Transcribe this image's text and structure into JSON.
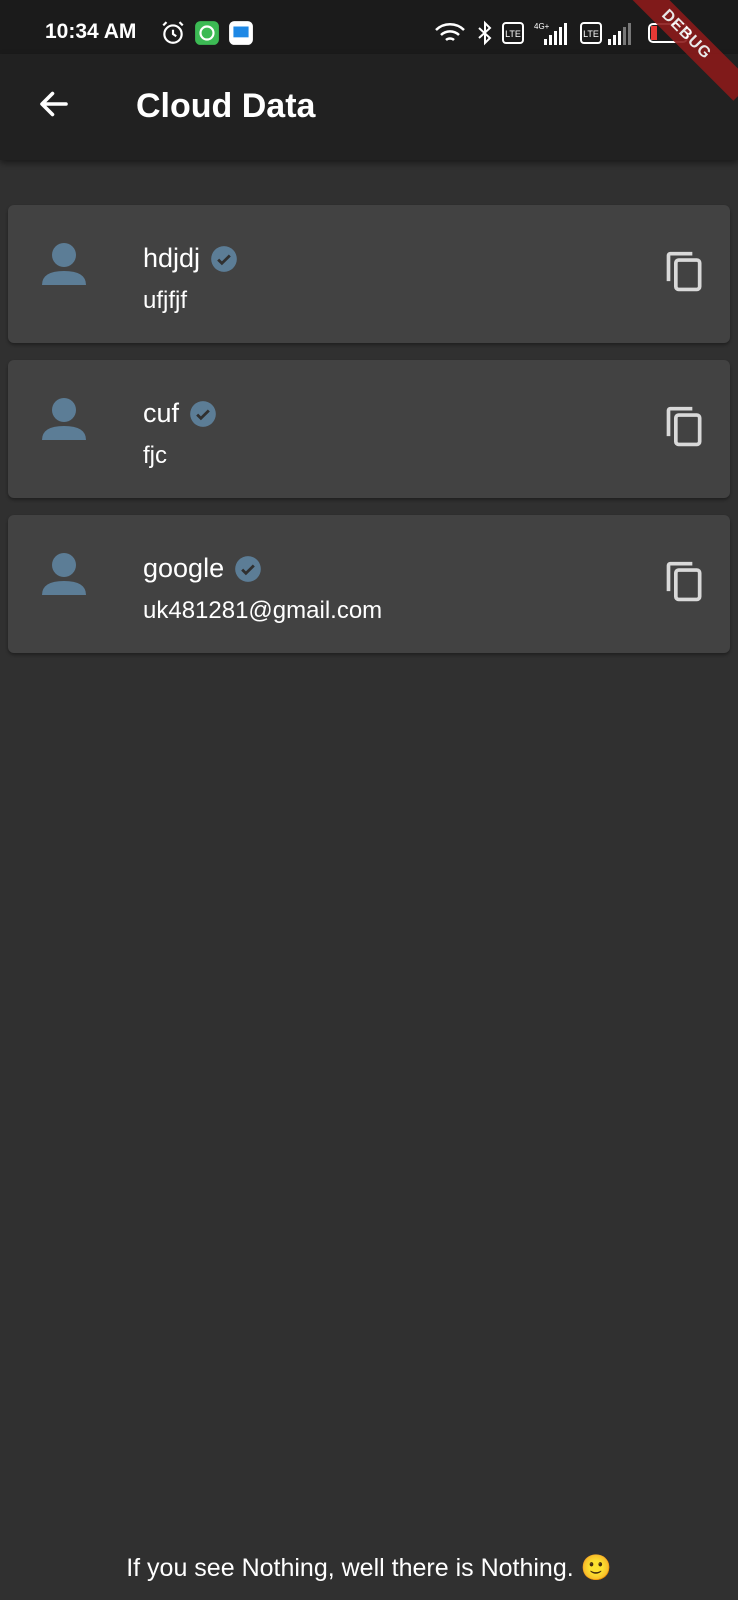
{
  "status_bar": {
    "time": "10:34 AM",
    "battery": "15",
    "icons": [
      "alarm-icon",
      "app-notification-icon",
      "app-notification-icon",
      "wifi-icon",
      "bluetooth-icon",
      "volte-icon",
      "signal-icon",
      "battery-icon"
    ]
  },
  "app_bar": {
    "title": "Cloud Data",
    "back_icon": "arrow-back-icon",
    "debug_label": "DEBUG"
  },
  "entries": [
    {
      "title": "hdjdj",
      "subtitle": "ufjfjf"
    },
    {
      "title": "cuf",
      "subtitle": "fjc"
    },
    {
      "title": "google",
      "subtitle": "uk481281@gmail.com"
    }
  ],
  "footer": {
    "message": "If you see Nothing, well there is Nothing. 🙂"
  },
  "colors": {
    "background": "#303030",
    "app_bar": "#212121",
    "card": "#424242",
    "accent_icon": "#5c7d96",
    "copy_icon": "#d9d9d9",
    "debug_ribbon": "#8b1a1a"
  }
}
